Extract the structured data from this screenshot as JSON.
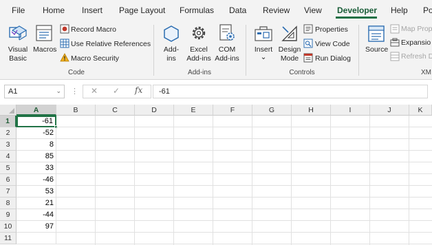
{
  "menu": {
    "tabs": [
      {
        "label": "File"
      },
      {
        "label": "Home"
      },
      {
        "label": "Insert"
      },
      {
        "label": "Page Layout"
      },
      {
        "label": "Formulas"
      },
      {
        "label": "Data"
      },
      {
        "label": "Review"
      },
      {
        "label": "View"
      },
      {
        "label": "Developer"
      },
      {
        "label": "Help"
      },
      {
        "label": "Po"
      }
    ],
    "active_index": 8
  },
  "ribbon": {
    "code": {
      "visual_basic_line1": "Visual",
      "visual_basic_line2": "Basic",
      "macros": "Macros",
      "record_macro": "Record Macro",
      "use_relative_references": "Use Relative References",
      "macro_security": "Macro Security",
      "group_label": "Code"
    },
    "addins": {
      "addins_line1": "Add-",
      "addins_line2": "ins",
      "excel_addins_line1": "Excel",
      "excel_addins_line2": "Add-ins",
      "com_addins_line1": "COM",
      "com_addins_line2": "Add-ins",
      "group_label": "Add-ins"
    },
    "controls": {
      "insert": "Insert",
      "insert_chevron": "⌄",
      "design_mode_line1": "Design",
      "design_mode_line2": "Mode",
      "properties": "Properties",
      "view_code": "View Code",
      "run_dialog": "Run Dialog",
      "group_label": "Controls"
    },
    "xml": {
      "source": "Source",
      "map_properties": "Map Prop",
      "expansion_packs": "Expansio",
      "refresh_data": "Refresh D",
      "group_label": "XM"
    }
  },
  "formula_bar": {
    "name_box": "A1",
    "chevron": "⌄",
    "dots": "⋮",
    "cancel": "✕",
    "enter": "✓",
    "fx": "fx",
    "value": "-61"
  },
  "grid": {
    "columns": [
      "A",
      "B",
      "C",
      "D",
      "E",
      "F",
      "G",
      "H",
      "I",
      "J",
      "K"
    ],
    "rows": [
      "1",
      "2",
      "3",
      "4",
      "5",
      "6",
      "7",
      "8",
      "9",
      "10",
      "11"
    ],
    "col_a_values": [
      "-61",
      "-52",
      "8",
      "85",
      "33",
      "-46",
      "53",
      "21",
      "-44",
      "97",
      ""
    ],
    "active_cell": "A1"
  },
  "colors": {
    "accent": "#217346",
    "ribbon_bg": "#f3f3f3",
    "header_bg": "#efefef"
  }
}
